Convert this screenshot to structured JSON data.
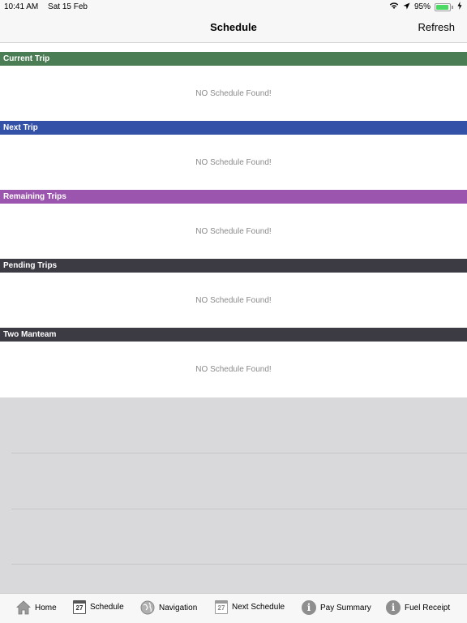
{
  "status_bar": {
    "time": "10:41 AM",
    "date": "Sat 15 Feb",
    "battery": "95%",
    "battery_level": 0.95
  },
  "nav": {
    "title": "Schedule",
    "refresh_label": "Refresh"
  },
  "sections": [
    {
      "title": "Current Trip",
      "color": "#4b7d55",
      "empty_text": "NO Schedule Found!"
    },
    {
      "title": "Next Trip",
      "color": "#3451a8",
      "empty_text": "NO Schedule Found!"
    },
    {
      "title": "Remaining Trips",
      "color": "#9c55ae",
      "empty_text": "NO Schedule Found!"
    },
    {
      "title": "Pending Trips",
      "color": "#3c3b44",
      "empty_text": "NO Schedule Found!"
    },
    {
      "title": "Two Manteam",
      "color": "#3c3b44",
      "empty_text": "NO Schedule Found!"
    }
  ],
  "tabs": [
    {
      "label": "Home",
      "icon": "home-icon"
    },
    {
      "label": "Schedule",
      "icon": "calendar-icon",
      "icon_text": "27"
    },
    {
      "label": "Navigation",
      "icon": "globe-icon"
    },
    {
      "label": "Next Schedule",
      "icon": "calendar-icon",
      "icon_text": "27"
    },
    {
      "label": "Pay Summary",
      "icon": "info-icon",
      "icon_text": "i"
    },
    {
      "label": "Fuel Receipt",
      "icon": "info-icon",
      "icon_text": "i"
    }
  ]
}
